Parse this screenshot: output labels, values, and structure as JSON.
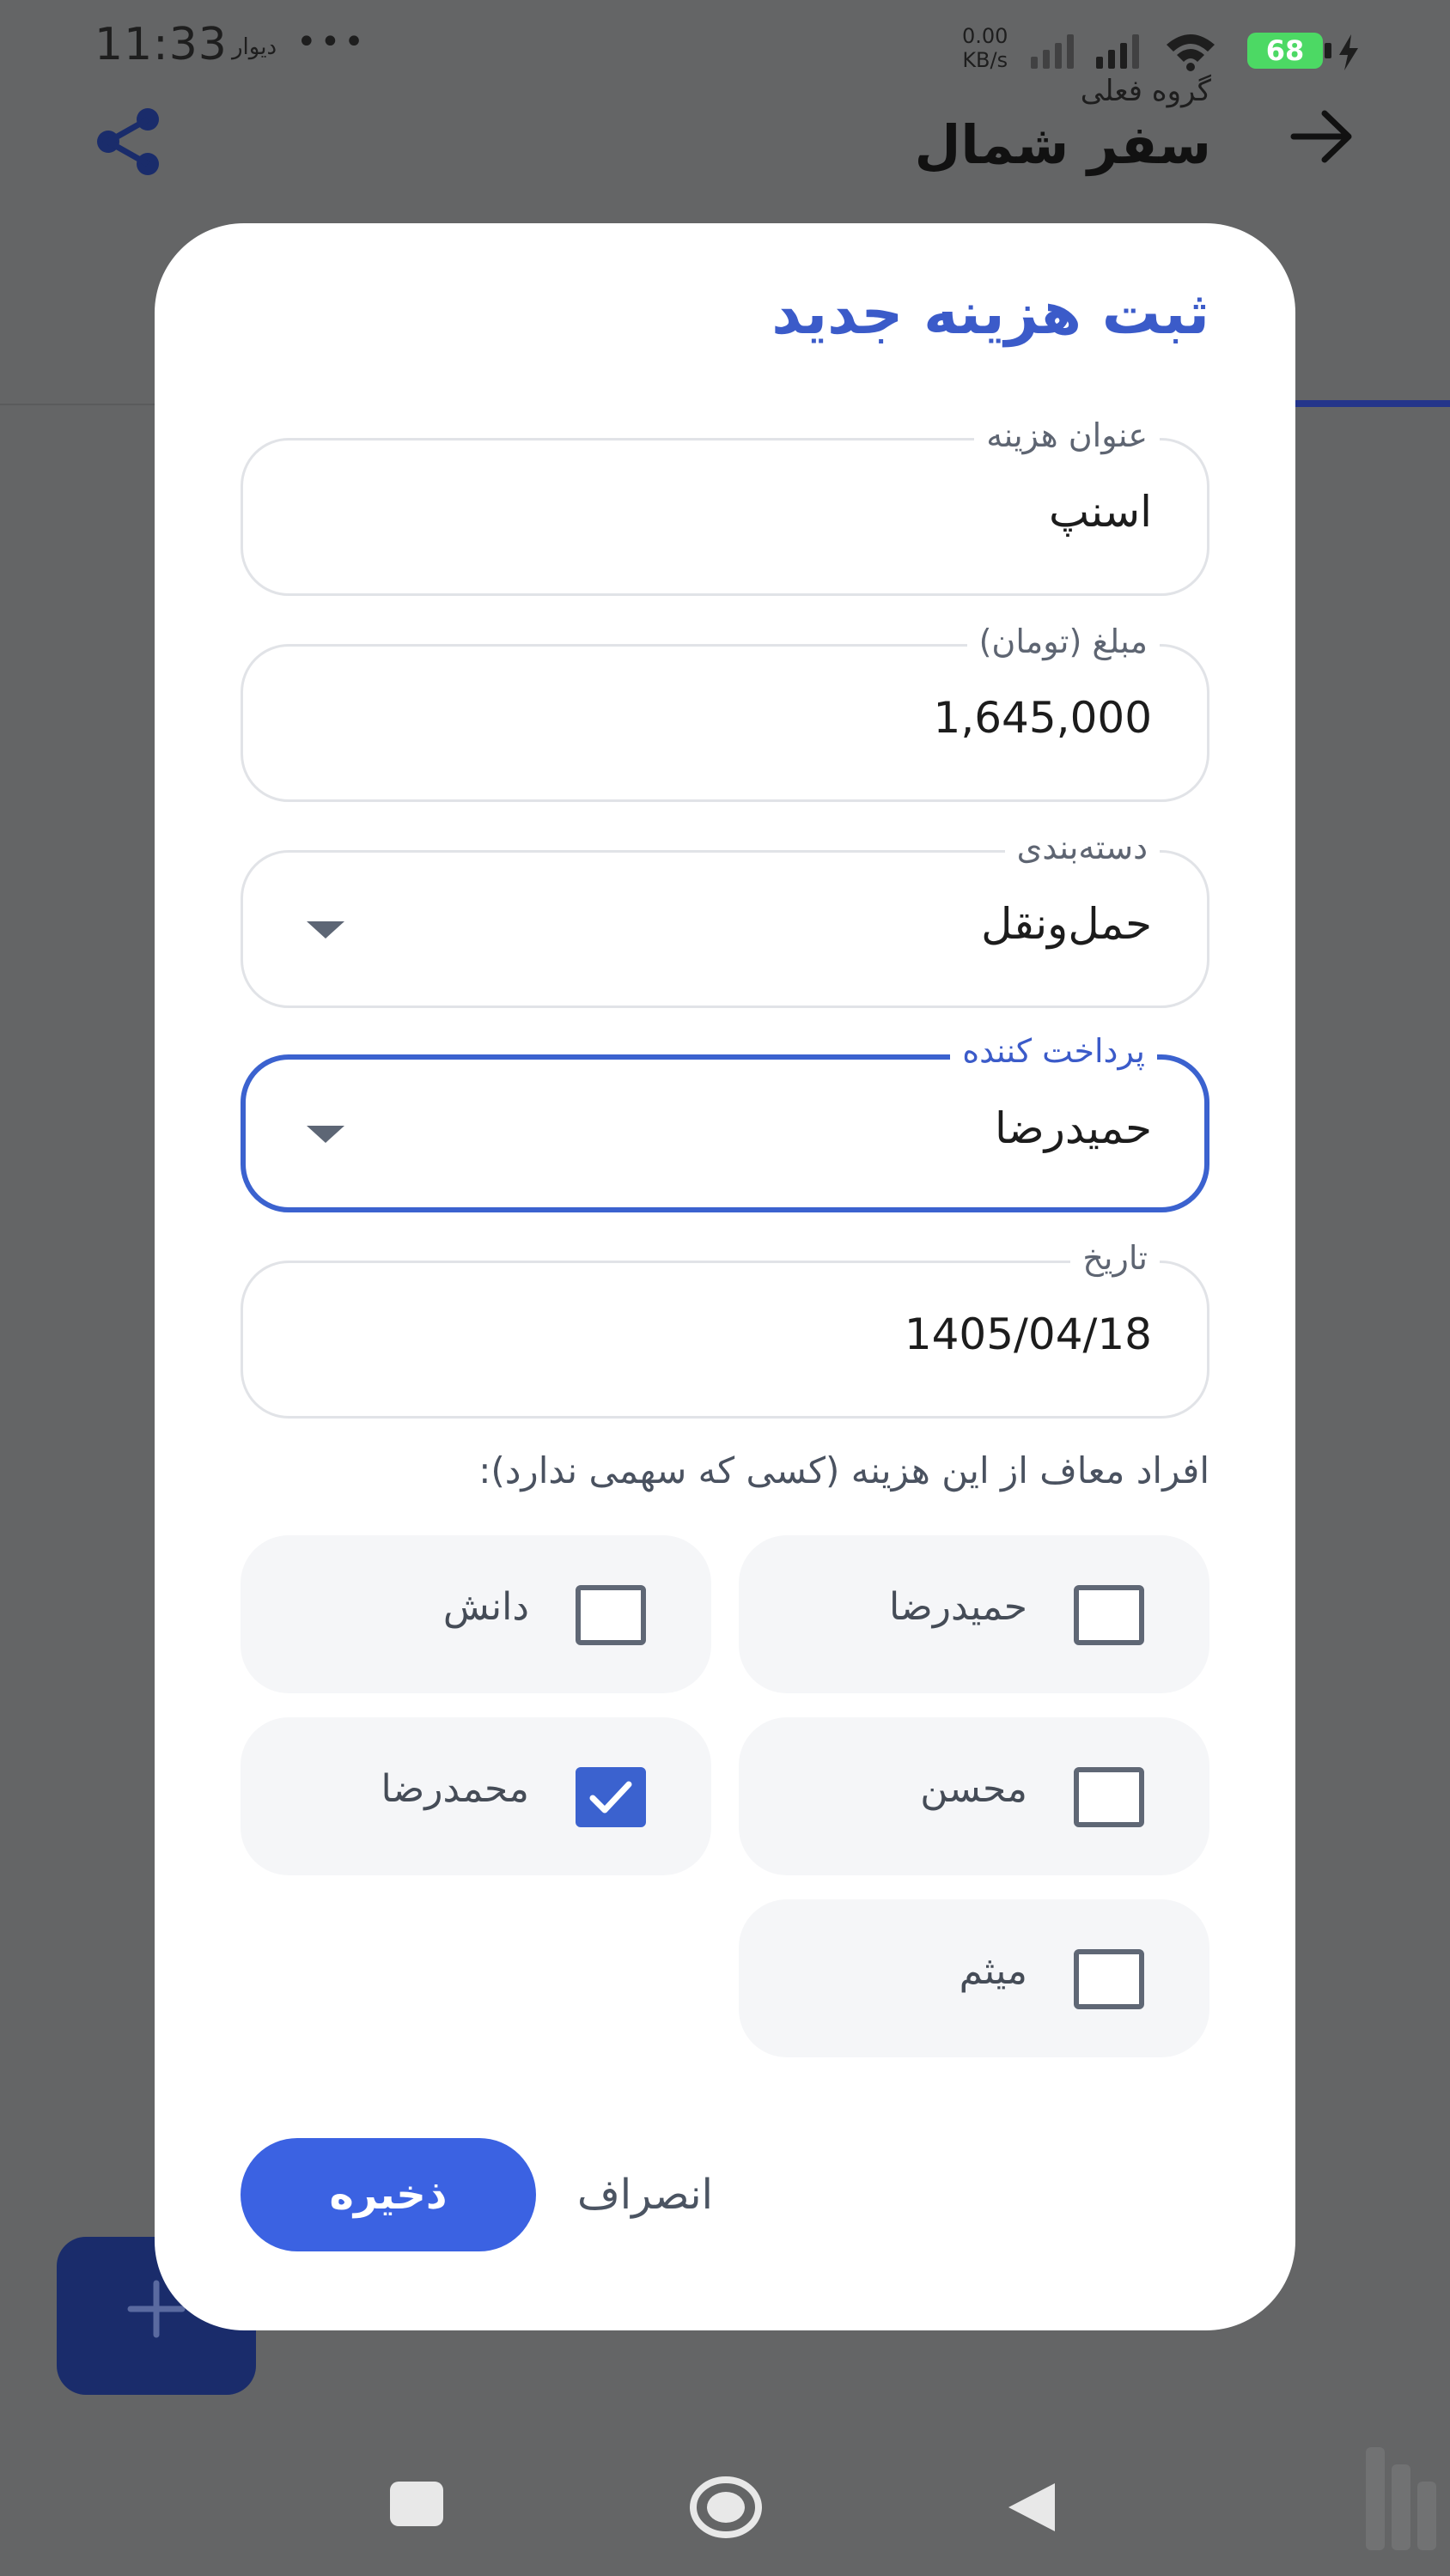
{
  "status_bar": {
    "time": "11:33",
    "app_name": "دیوار",
    "dots": "•••",
    "net_speed_value": "0.00",
    "net_speed_unit": "KB/s",
    "battery": "68"
  },
  "header": {
    "group_label": "گروه فعلی",
    "group_name": "سفر شمال",
    "icons": [
      "share-icon",
      "arrow-right-icon"
    ]
  },
  "dialog": {
    "title": "ثبت هزینه جدید",
    "fields": {
      "title": {
        "label": "عنوان هزینه",
        "value": "اسنپ"
      },
      "amount": {
        "label": "مبلغ (تومان)",
        "value": "1,645,000"
      },
      "category": {
        "label": "دسته‌بندی",
        "value": "حمل‌ونقل"
      },
      "payer": {
        "label": "پرداخت کننده",
        "value": "حمیدرضا"
      },
      "date": {
        "label": "تاریخ",
        "value": "1405/04/18"
      }
    },
    "exempt_heading": "افراد معاف از این هزینه (کسی که سهمی ندارد):",
    "members": [
      {
        "name": "حمیدرضا",
        "checked": false
      },
      {
        "name": "دانش",
        "checked": false
      },
      {
        "name": "محسن",
        "checked": false
      },
      {
        "name": "محمدرضا",
        "checked": true
      },
      {
        "name": "میثم",
        "checked": false
      }
    ],
    "save_label": "ذخیره",
    "cancel_label": "انصراف"
  },
  "colors": {
    "accent": "#3b62e2",
    "title": "#3b5bc9",
    "scrim": "#646566",
    "fab": "#1a2c6b"
  }
}
